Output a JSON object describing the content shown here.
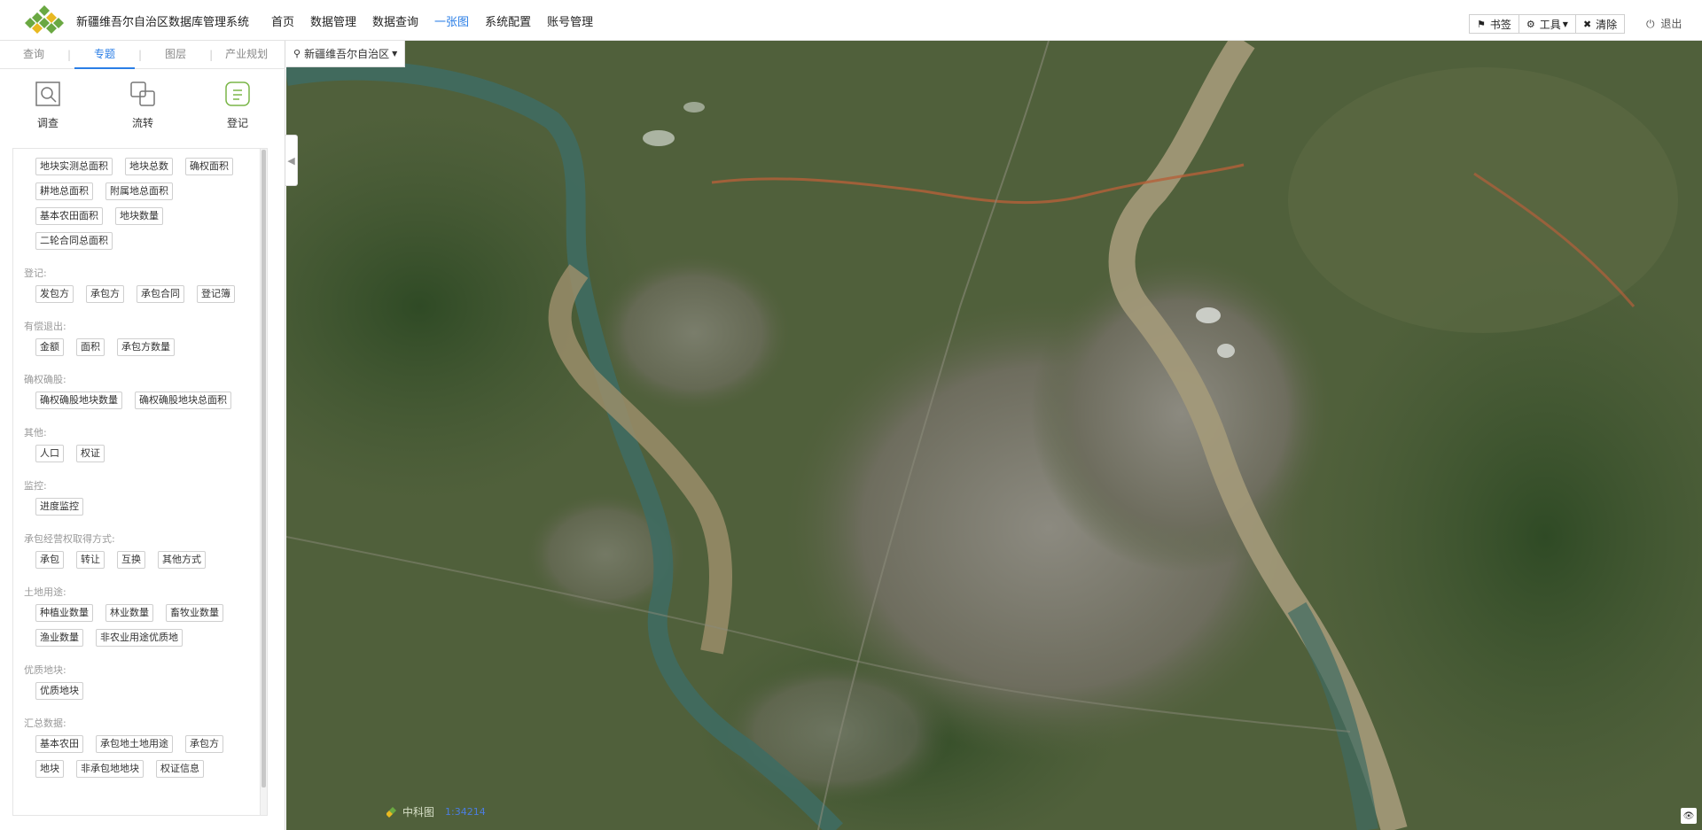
{
  "header": {
    "title": "新疆维吾尔自治区数据库管理系统",
    "nav": [
      {
        "label": "首页",
        "active": false
      },
      {
        "label": "数据管理",
        "active": false
      },
      {
        "label": "数据查询",
        "active": false
      },
      {
        "label": "一张图",
        "active": true
      },
      {
        "label": "系统配置",
        "active": false
      },
      {
        "label": "账号管理",
        "active": false
      }
    ],
    "tools": {
      "bookmark": "书签",
      "tools": "工具",
      "clear": "清除"
    },
    "logout": "退出"
  },
  "sidebar": {
    "tabs": [
      {
        "label": "查询",
        "active": false
      },
      {
        "label": "专题",
        "active": true
      },
      {
        "label": "图层",
        "active": false
      },
      {
        "label": "产业规划",
        "active": false
      }
    ],
    "icons": [
      {
        "label": "调查",
        "icon": "search-survey-icon"
      },
      {
        "label": "流转",
        "icon": "transfer-icon"
      },
      {
        "label": "登记",
        "icon": "register-icon"
      }
    ],
    "sections": [
      {
        "title": "",
        "chips": [
          "地块实测总面积",
          "地块总数",
          "确权面积",
          "耕地总面积",
          "附属地总面积",
          "基本农田面积",
          "地块数量",
          "二轮合同总面积"
        ]
      },
      {
        "title": "登记:",
        "chips": [
          "发包方",
          "承包方",
          "承包合同",
          "登记簿"
        ]
      },
      {
        "title": "有偿退出:",
        "chips": [
          "金额",
          "面积",
          "承包方数量"
        ]
      },
      {
        "title": "确权确股:",
        "chips": [
          "确权确股地块数量",
          "确权确股地块总面积"
        ]
      },
      {
        "title": "其他:",
        "chips": [
          "人口",
          "权证"
        ]
      },
      {
        "title": "监控:",
        "chips": [
          "进度监控"
        ]
      },
      {
        "title": "承包经营权取得方式:",
        "chips": [
          "承包",
          "转让",
          "互换",
          "其他方式"
        ]
      },
      {
        "title": "土地用途:",
        "chips": [
          "种植业数量",
          "林业数量",
          "畜牧业数量",
          "渔业数量",
          "非农业用途优质地"
        ]
      },
      {
        "title": "优质地块:",
        "chips": [
          "优质地块"
        ]
      },
      {
        "title": "汇总数据:",
        "chips": [
          "基本农田",
          "承包地土地用途",
          "承包方",
          "地块",
          "非承包地地块",
          "权证信息"
        ]
      }
    ]
  },
  "map": {
    "region": "新疆维吾尔自治区",
    "credit_text": "中科图",
    "credit_number": "1:34214"
  },
  "colors": {
    "accent": "#2a7ee6",
    "logo_green": "#6aa842",
    "logo_yellow": "#e8b921"
  }
}
